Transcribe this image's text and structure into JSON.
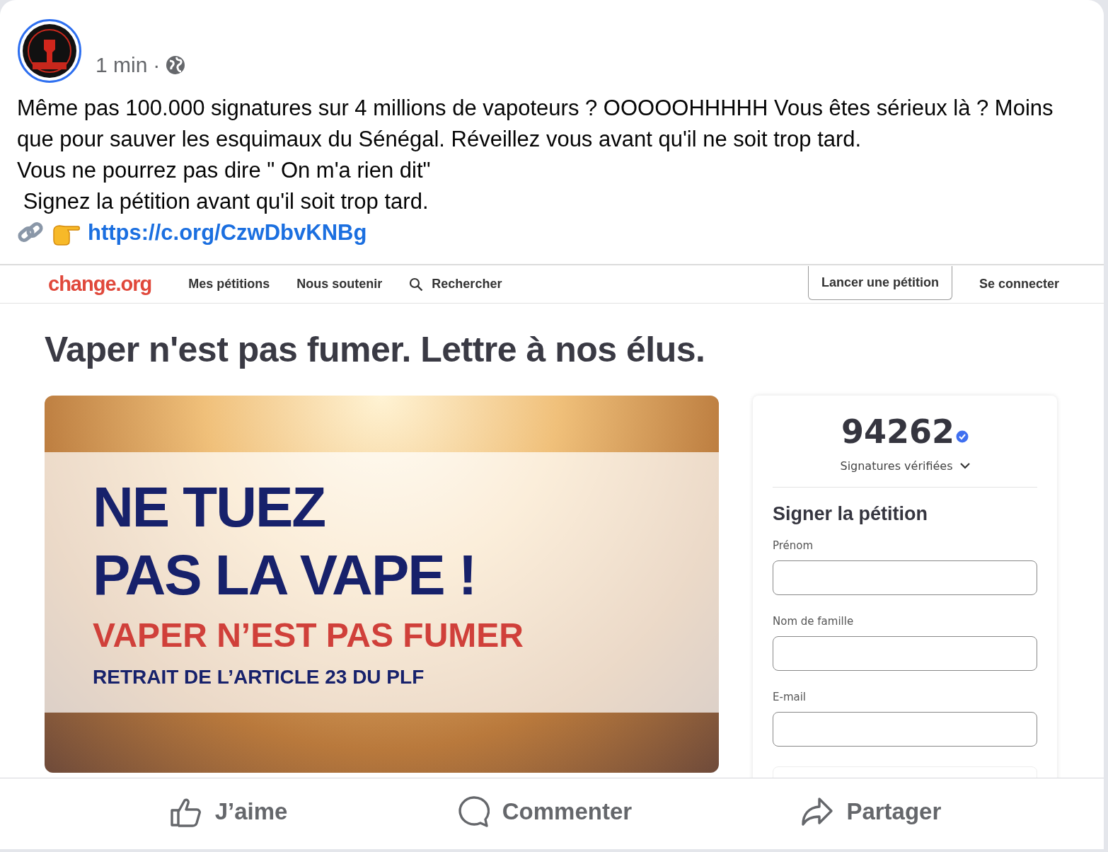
{
  "post": {
    "time": "1 min",
    "separator": "·",
    "paragraphs": [
      "Même pas 100.000 signatures sur 4 millions de vapoteurs ? OOOOOHHHHH Vous êtes sérieux là ? Moins que pour sauver les esquimaux du Sénégal. Réveillez vous avant qu'il ne soit trop tard.",
      "Vous ne pourrez pas dire \" On m'a rien dit\"",
      " Signez la pétition avant qu'il soit trop tard."
    ],
    "link": "https://c.org/CzwDbvKNBg"
  },
  "embed": {
    "logo": "change.org",
    "nav": [
      {
        "label": "Mes pétitions",
        "kind": "link"
      },
      {
        "label": "Nous soutenir",
        "kind": "link"
      },
      {
        "label": "Rechercher",
        "kind": "search"
      }
    ],
    "buttons": [
      {
        "label": "Lancer une pétition",
        "kind": "outlined"
      },
      {
        "label": "Se connecter",
        "kind": "plain"
      }
    ],
    "title": "Vaper n'est pas fumer. Lettre à nos élus.",
    "banner": {
      "headline": [
        "NE TUEZ",
        "PAS LA VAPE !"
      ],
      "subtitle": "VAPER N’EST PAS FUMER",
      "note": "RETRAIT DE L’ARTICLE 23 DU PLF"
    },
    "counter": {
      "count": "94262",
      "label": "Signatures vérifiées",
      "verified": true
    },
    "form": {
      "title": "Signer la pétition",
      "fields": [
        {
          "label": "Prénom"
        },
        {
          "label": "Nom de famille"
        },
        {
          "label": "E-mail"
        }
      ]
    }
  },
  "actions": [
    {
      "label": "J’aime",
      "kind": "like"
    },
    {
      "label": "Commenter",
      "kind": "comment"
    },
    {
      "label": "Partager",
      "kind": "share"
    }
  ]
}
